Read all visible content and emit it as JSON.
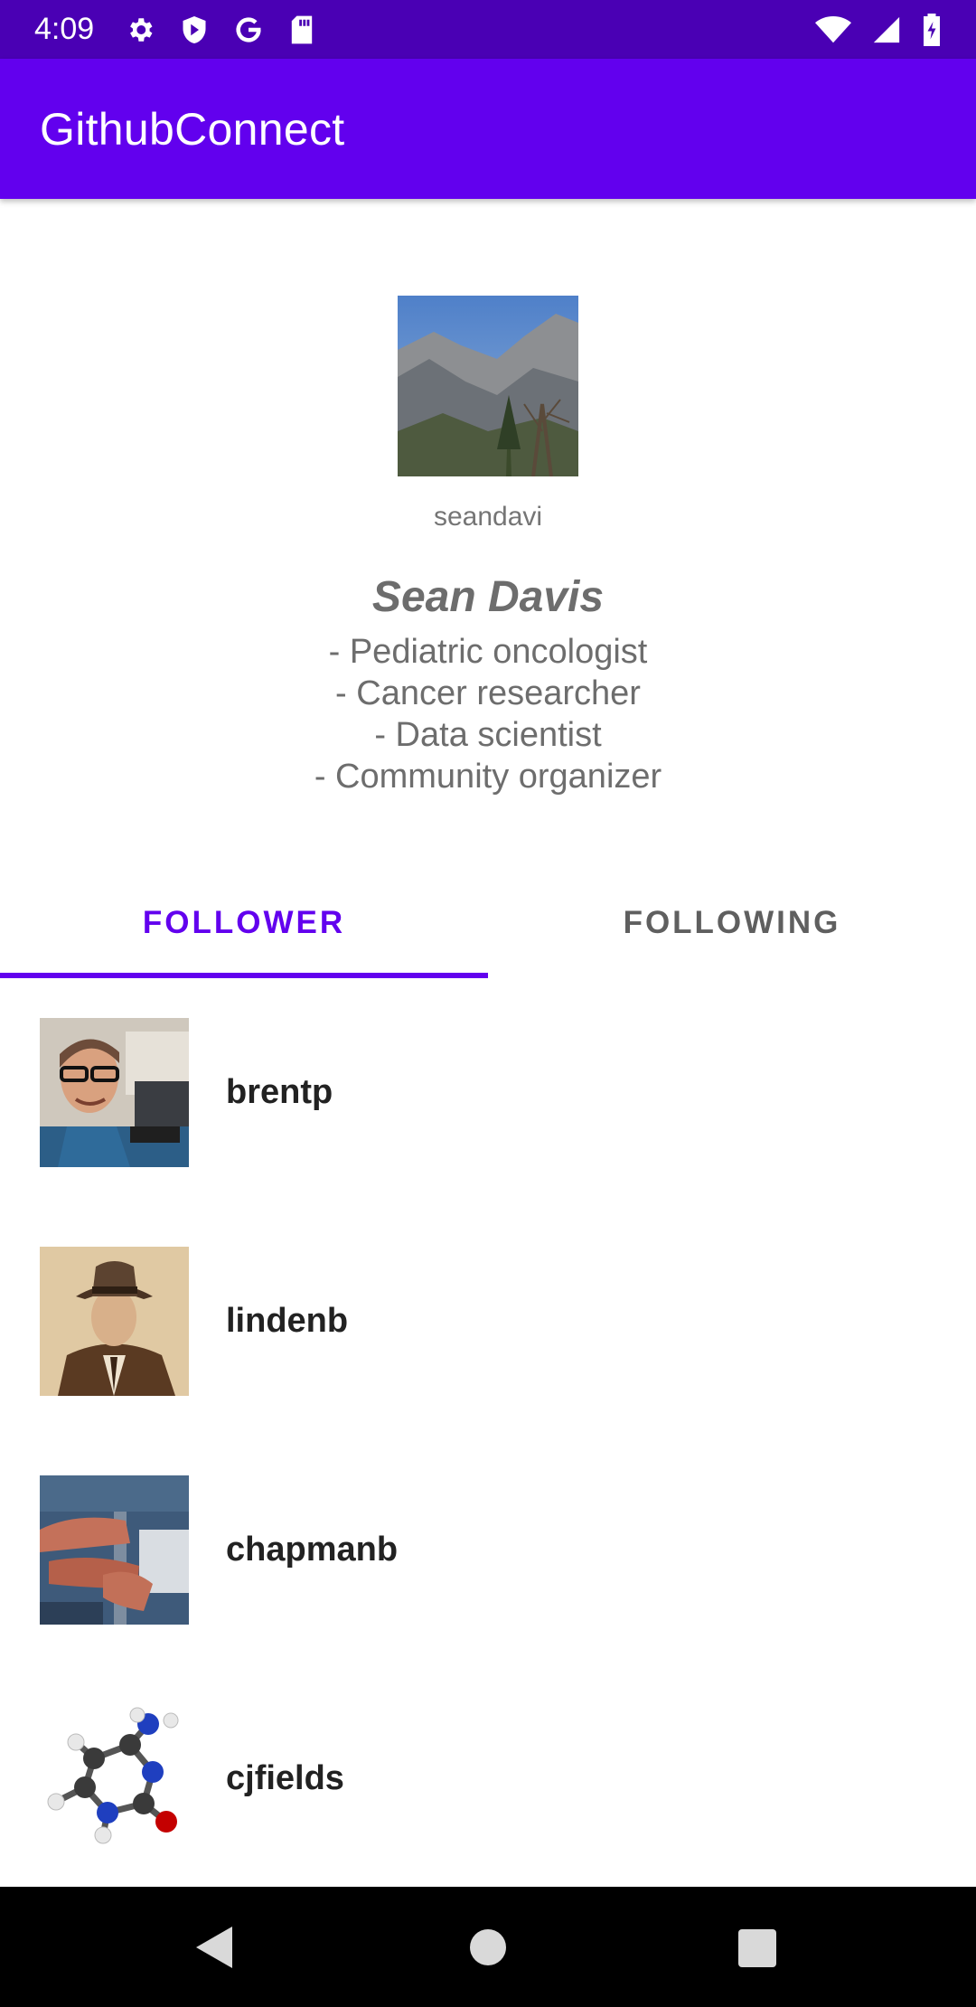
{
  "status_bar": {
    "time": "4:09",
    "icons_left": [
      "gear-icon",
      "shield-icon",
      "google-icon",
      "sd-card-icon"
    ],
    "icons_right": [
      "wifi-icon",
      "signal-icon",
      "battery-icon"
    ]
  },
  "app_bar": {
    "title": "GithubConnect",
    "color": "#6200ee"
  },
  "profile": {
    "username": "seandavi",
    "name": "Sean Davis",
    "bio": [
      "- Pediatric oncologist",
      "- Cancer researcher",
      "- Data scientist",
      "- Community organizer"
    ]
  },
  "tabs": [
    {
      "label": "FOLLOWER",
      "active": true
    },
    {
      "label": "FOLLOWING",
      "active": false
    }
  ],
  "followers": [
    {
      "login": "brentp"
    },
    {
      "login": "lindenb"
    },
    {
      "login": "chapmanb"
    },
    {
      "login": "cjfields"
    }
  ],
  "nav_bar": {
    "icons": [
      "back-icon",
      "home-icon",
      "recents-icon"
    ]
  }
}
